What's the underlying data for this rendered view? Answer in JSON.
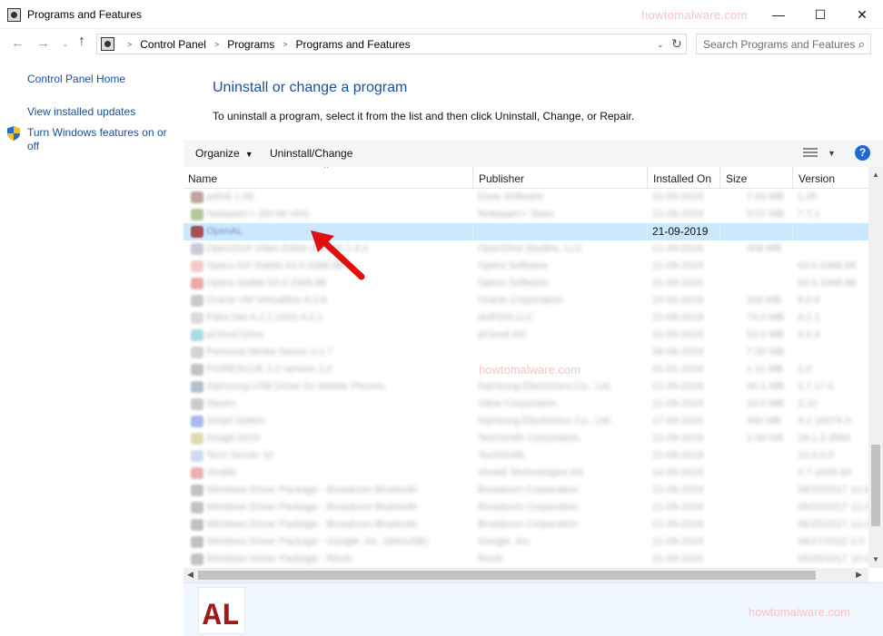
{
  "window": {
    "title": "Programs and Features",
    "watermark": "howtomalware.com",
    "icon": "control-panel-icon",
    "controls": {
      "minimize": "—",
      "maximize": "☐",
      "close": "✕"
    }
  },
  "nav": {
    "back": "←",
    "forward": "→",
    "recent": "⌄",
    "up": "↑",
    "breadcrumb": [
      "Control Panel",
      "Programs",
      "Programs and Features"
    ],
    "search_placeholder": "Search Programs and Features"
  },
  "sidebar": {
    "links": [
      "Control Panel Home",
      "View installed updates",
      "Turn Windows features on or off"
    ]
  },
  "main": {
    "heading": "Uninstall or change a program",
    "description": "To uninstall a program, select it from the list and then click Uninstall, Change, or Repair."
  },
  "toolbar": {
    "organize": "Organize",
    "uninstall_change": "Uninstall/Change",
    "help": "?"
  },
  "list": {
    "columns": [
      "Name",
      "Publisher",
      "Installed On",
      "Size",
      "Version"
    ],
    "rows": [
      {
        "name": "avlink 1.05",
        "publisher": "Dave Software",
        "date": "21-09-2019",
        "size": "7.00 MB",
        "version": "1.05",
        "color": "#8a5a4a"
      },
      {
        "name": "Notepad++ (64-bit x64)",
        "publisher": "Notepad++ Team",
        "date": "21-09-2019",
        "size": "9.07 MB",
        "version": "7.7.1",
        "color": "#7a9a4a"
      },
      {
        "name": "OpenAL",
        "publisher": "",
        "date": "21-09-2019",
        "size": "",
        "version": "",
        "color": "#9e2a2a",
        "selected": true
      },
      {
        "name": "OpenShot Video Editor (64-bit) 2.4.4",
        "publisher": "OpenShot Studios, LLC",
        "date": "21-09-2019",
        "size": "308 MB",
        "version": "",
        "color": "#a0a0c0"
      },
      {
        "name": "Opera GX Stable 63.0.3368.88",
        "publisher": "Opera Software",
        "date": "21-09-2019",
        "size": "",
        "version": "63.0.3368.88",
        "color": "#f0a0a0"
      },
      {
        "name": "Opera Stable 63.0.3368.88",
        "publisher": "Opera Software",
        "date": "21-09-2019",
        "size": "",
        "version": "63.0.3368.88",
        "color": "#e06060"
      },
      {
        "name": "Oracle VM VirtualBox 6.0.6",
        "publisher": "Oracle Corporation",
        "date": "15-02-2019",
        "size": "200 MB",
        "version": "6.0.6",
        "color": "#a0a0a0"
      },
      {
        "name": "Paint.Net 4.2.1 (x64) 4.2.1",
        "publisher": "dotPDN LLC",
        "date": "21-09-2019",
        "size": "70.0 MB",
        "version": "4.2.1",
        "color": "#c0c0c0"
      },
      {
        "name": "pCloud Drive",
        "publisher": "pCloud AG",
        "date": "21-09-2019",
        "size": "52.0 MB",
        "version": "4.0.4",
        "color": "#60c0d0"
      },
      {
        "name": "Personal Media Server 2.1.7",
        "publisher": "",
        "date": "06-06-2019",
        "size": "7.00 MB",
        "version": "",
        "color": "#b0b0b0"
      },
      {
        "name": "PIXRESCUE 2.0 version 1.0",
        "publisher": "",
        "date": "01-01-2019",
        "size": "1.11 MB",
        "version": "1.0",
        "color": "#909090"
      },
      {
        "name": "Samsung USB Driver for Mobile Phones",
        "publisher": "Samsung Electronics Co., Ltd.",
        "date": "21-09-2019",
        "size": "40.1 MB",
        "version": "1.7.17.0",
        "color": "#7090a0"
      },
      {
        "name": "Steam",
        "publisher": "Valve Corporation",
        "date": "21-09-2019",
        "size": "10.0 MB",
        "version": "2.10",
        "color": "#a0a0a0"
      },
      {
        "name": "Smart Switch",
        "publisher": "Samsung Electronics Co., Ltd.",
        "date": "17-09-2019",
        "size": "450 MB",
        "version": "4.2.19074.4",
        "color": "#6080e0"
      },
      {
        "name": "Snagit 2019",
        "publisher": "TechSmith Corporation",
        "date": "21-09-2019",
        "size": "1.00 GB",
        "version": "19.1.2.3560",
        "color": "#c0c070"
      },
      {
        "name": "Tech Server 10",
        "publisher": "TechSmith",
        "date": "21-09-2019",
        "size": "",
        "version": "10.0.0.0",
        "color": "#a0c0e0"
      },
      {
        "name": "Vivaldi",
        "publisher": "Vivaldi Technologies AS",
        "date": "14-09-2019",
        "size": "",
        "version": "2.7.1628.33",
        "color": "#e07070"
      },
      {
        "name": "Windows Driver Package - Broadcom Bluetooth",
        "publisher": "Broadcom Corporation",
        "date": "21-09-2019",
        "size": "",
        "version": "06/20/2017 12.0",
        "color": "#909090"
      },
      {
        "name": "Windows Driver Package - Broadcom Bluetooth",
        "publisher": "Broadcom Corporation",
        "date": "21-09-2019",
        "size": "",
        "version": "06/20/2017 12.0",
        "color": "#909090"
      },
      {
        "name": "Windows Driver Package - Broadcom Bluetooth",
        "publisher": "Broadcom Corporation",
        "date": "21-09-2019",
        "size": "",
        "version": "06/20/2017 12.0",
        "color": "#909090"
      },
      {
        "name": "Windows Driver Package - Google, Inc. (WinUSB)",
        "publisher": "Google, Inc.",
        "date": "21-09-2019",
        "size": "",
        "version": "08/27/2012 2.0",
        "color": "#909090"
      },
      {
        "name": "Windows Driver Package - Ricoh",
        "publisher": "Ricoh",
        "date": "21-09-2019",
        "size": "",
        "version": "06/29/2017 10.0",
        "color": "#909090"
      }
    ]
  },
  "details": {
    "logo_text": "AL",
    "logo_color": "#9e1b1b",
    "watermark": "howtomalware.com"
  },
  "annotation": {
    "arrow_color": "#e01010"
  }
}
